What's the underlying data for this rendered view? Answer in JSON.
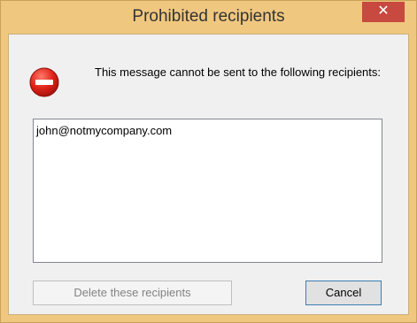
{
  "window": {
    "title": "Prohibited recipients",
    "close_label": "✕",
    "accent_color": "#f0c77f",
    "close_color": "#c7493f"
  },
  "dialog": {
    "icon": "stop-icon",
    "message": "This message cannot be sent to the following recipients:",
    "recipients": [
      "john@notmycompany.com"
    ]
  },
  "buttons": {
    "delete_label": "Delete these recipients",
    "delete_enabled": false,
    "cancel_label": "Cancel"
  }
}
